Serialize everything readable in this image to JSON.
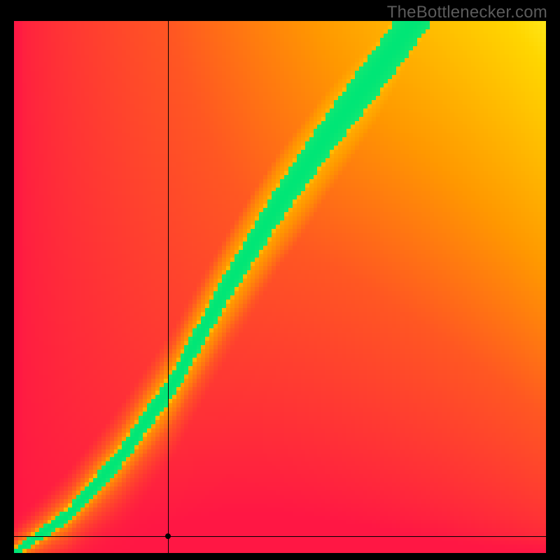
{
  "watermark": "TheBottlenecker.com",
  "marker": {
    "x_frac": 0.29,
    "y_frac": 0.968
  },
  "chart_data": {
    "type": "heatmap",
    "title": "",
    "xlabel": "",
    "ylabel": "",
    "xlim": [
      0,
      1
    ],
    "ylim": [
      0,
      1
    ],
    "grid_size": 128,
    "annotations": [
      "crosshair-vertical",
      "crosshair-horizontal",
      "marker-dot"
    ],
    "colormap": [
      {
        "t": 0.0,
        "color": "#ff1744"
      },
      {
        "t": 0.35,
        "color": "#ff5722"
      },
      {
        "t": 0.55,
        "color": "#ff9800"
      },
      {
        "t": 0.78,
        "color": "#ffd600"
      },
      {
        "t": 0.9,
        "color": "#ffff3b"
      },
      {
        "t": 1.0,
        "color": "#00e676"
      }
    ],
    "ridge_curve": {
      "description": "Green ridge curve y(x) of maximum fitness",
      "points": [
        {
          "x": 0.0,
          "y": 0.0
        },
        {
          "x": 0.1,
          "y": 0.07
        },
        {
          "x": 0.2,
          "y": 0.18
        },
        {
          "x": 0.3,
          "y": 0.32
        },
        {
          "x": 0.4,
          "y": 0.5
        },
        {
          "x": 0.5,
          "y": 0.66
        },
        {
          "x": 0.6,
          "y": 0.8
        },
        {
          "x": 0.7,
          "y": 0.93
        },
        {
          "x": 0.75,
          "y": 1.0
        }
      ]
    },
    "ridge_width": 0.04,
    "background_gradient": {
      "top_right": "warm-yellow-orange",
      "left": "red",
      "bottom": "red"
    }
  }
}
